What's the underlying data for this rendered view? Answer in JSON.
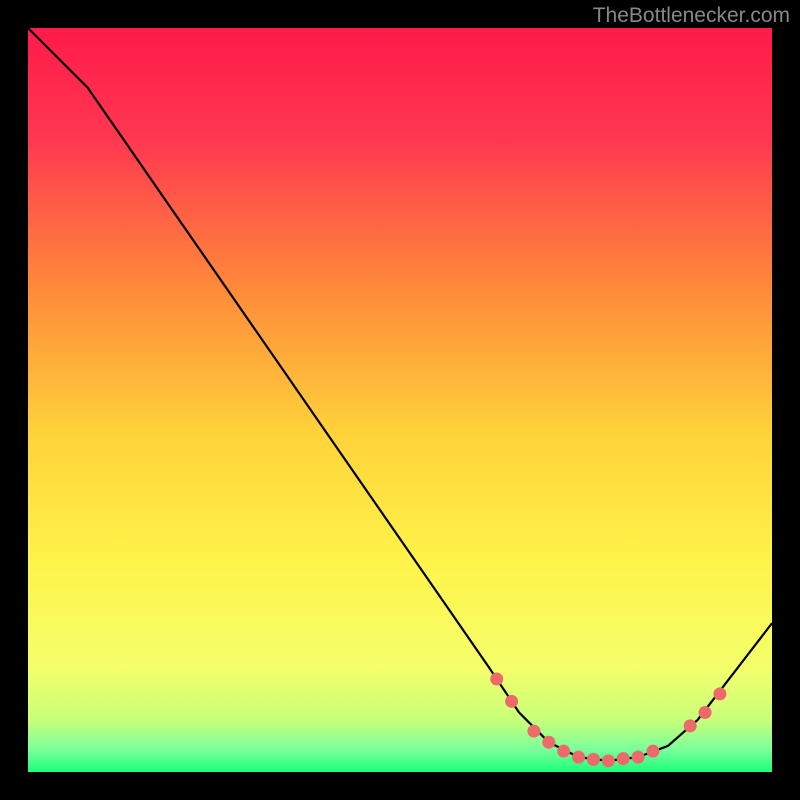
{
  "watermark": "TheBottlenecker.com",
  "chart_data": {
    "type": "line",
    "title": "",
    "xlabel": "",
    "ylabel": "",
    "xlim": [
      0,
      100
    ],
    "ylim": [
      0,
      100
    ],
    "curve": [
      {
        "x": 0,
        "y": 100
      },
      {
        "x": 8,
        "y": 92
      },
      {
        "x": 62,
        "y": 14
      },
      {
        "x": 66,
        "y": 8
      },
      {
        "x": 70,
        "y": 4
      },
      {
        "x": 74,
        "y": 2
      },
      {
        "x": 78,
        "y": 1.5
      },
      {
        "x": 82,
        "y": 2
      },
      {
        "x": 86,
        "y": 3.5
      },
      {
        "x": 90,
        "y": 7
      },
      {
        "x": 100,
        "y": 20
      }
    ],
    "markers": [
      {
        "x": 63,
        "y": 12.5
      },
      {
        "x": 65,
        "y": 9.5
      },
      {
        "x": 68,
        "y": 5.5
      },
      {
        "x": 70,
        "y": 4
      },
      {
        "x": 72,
        "y": 2.8
      },
      {
        "x": 74,
        "y": 2
      },
      {
        "x": 76,
        "y": 1.7
      },
      {
        "x": 78,
        "y": 1.5
      },
      {
        "x": 80,
        "y": 1.8
      },
      {
        "x": 82,
        "y": 2
      },
      {
        "x": 84,
        "y": 2.8
      },
      {
        "x": 89,
        "y": 6.2
      },
      {
        "x": 91,
        "y": 8
      },
      {
        "x": 93,
        "y": 10.5
      }
    ],
    "gradient_stops": [
      {
        "offset": 0,
        "color": "#ff1a4a"
      },
      {
        "offset": 0.15,
        "color": "#ff3850"
      },
      {
        "offset": 0.35,
        "color": "#ff8a3a"
      },
      {
        "offset": 0.55,
        "color": "#ffd43a"
      },
      {
        "offset": 0.72,
        "color": "#fff44a"
      },
      {
        "offset": 0.86,
        "color": "#f4ff6a"
      },
      {
        "offset": 0.93,
        "color": "#c8ff7a"
      },
      {
        "offset": 0.97,
        "color": "#7aff9a"
      },
      {
        "offset": 1.0,
        "color": "#1aff7a"
      }
    ],
    "colors": {
      "line": "#000000",
      "marker": "#ed6a6a",
      "background": "#000000"
    }
  }
}
